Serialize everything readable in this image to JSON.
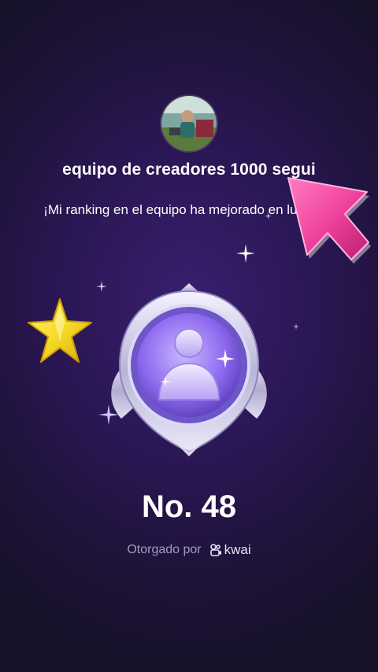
{
  "team": {
    "name": "equipo de creadores 1000 segui",
    "message": "¡Mi ranking en el equipo ha mejorado en lugares!"
  },
  "ranking": {
    "label": "No. 48"
  },
  "footer": {
    "awarded_by": "Otorgado por",
    "brand": "kwai"
  },
  "icons": {
    "avatar": "profile-photo",
    "badge": "team-medal-icon",
    "sticker_star": "yellow-star-icon",
    "sticker_cursor": "pink-arrow-cursor-icon",
    "brand_logo": "kwai-logo-icon"
  },
  "colors": {
    "background": "#2a1652",
    "accent_purple": "#8f6bf0",
    "sticker_pink": "#ee3f9a",
    "sticker_yellow": "#f7dc2a",
    "muted_text": "#a49bbd"
  }
}
